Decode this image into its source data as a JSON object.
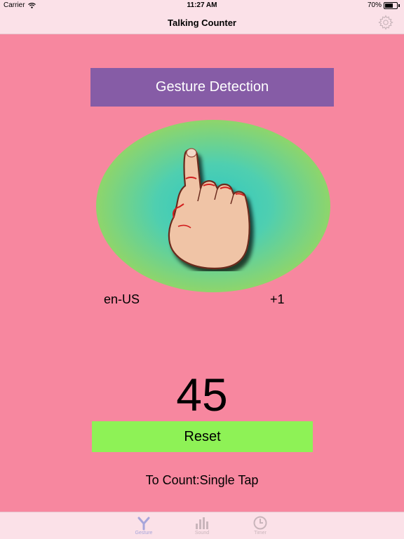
{
  "status_bar": {
    "carrier": "Carrier",
    "time": "11:27 AM",
    "battery_percent": "70%",
    "battery_level": 0.7
  },
  "nav": {
    "title": "Talking Counter",
    "settings_icon": "gear-icon"
  },
  "gesture": {
    "header": "Gesture Detection",
    "hand_icon": "tap-hand-icon",
    "locale": "en-US",
    "increment": "+1"
  },
  "counter": {
    "value": "45",
    "reset_label": "Reset",
    "mode_text": "To Count:Single Tap"
  },
  "tabs": [
    {
      "label": "Gesture",
      "icon": "gesture-icon",
      "active": true
    },
    {
      "label": "Sound",
      "icon": "bar-chart-icon",
      "active": false
    },
    {
      "label": "Timer",
      "icon": "clock-icon",
      "active": false
    }
  ],
  "colors": {
    "background": "#f7879f",
    "header": "#865ca6",
    "reset": "#8ef256",
    "bars": "#fbe1e8"
  }
}
